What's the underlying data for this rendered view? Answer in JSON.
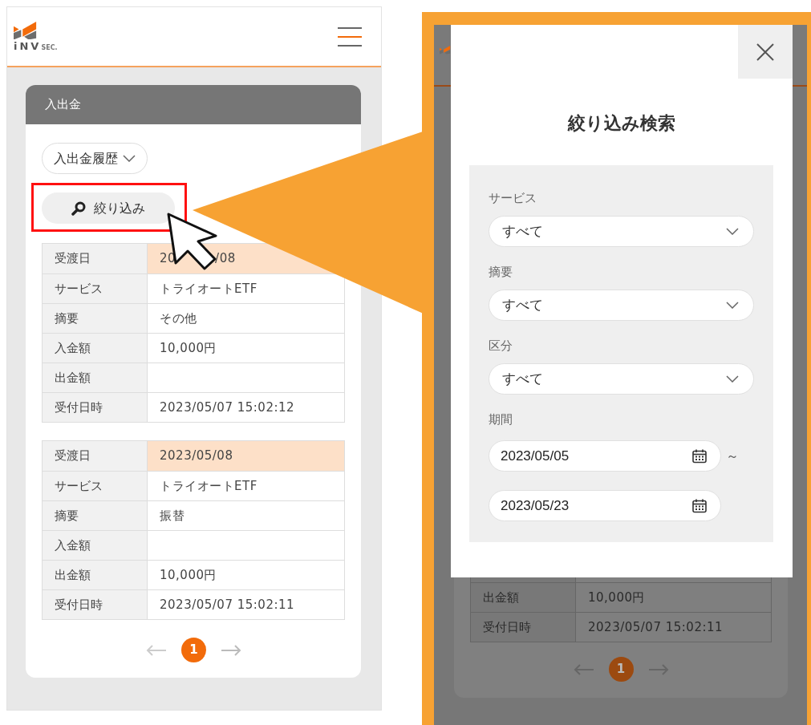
{
  "left_screen": {
    "header": {
      "logo_text": "iNV",
      "logo_suffix": "SEC."
    },
    "section_title": "入出金",
    "history_dropdown": "入出金履歴",
    "filter_button": "絞り込み",
    "records": [
      {
        "fields": [
          {
            "label": "受渡日",
            "value_parts": [
              "20",
              "/08"
            ],
            "highlight": true
          },
          {
            "label": "サービス",
            "value": "トライオートETF",
            "highlight": false
          },
          {
            "label": "摘要",
            "value": "その他",
            "highlight": false
          },
          {
            "label": "入金額",
            "value": "10,000円",
            "highlight": false
          },
          {
            "label": "出金額",
            "highlight": false
          },
          {
            "label": "受付日時",
            "value": "2023/05/07 15:02:12",
            "highlight": false
          }
        ]
      },
      {
        "fields": [
          {
            "label": "受渡日",
            "value": "2023/05/08",
            "highlight": true
          },
          {
            "label": "サービス",
            "value": "トライオートETF",
            "highlight": false
          },
          {
            "label": "摘要",
            "value": "振替",
            "highlight": false
          },
          {
            "label": "入金額",
            "highlight": false
          },
          {
            "label": "出金額",
            "value": "10,000円",
            "highlight": false
          },
          {
            "label": "受付日時",
            "value": "2023/05/07 15:02:11",
            "highlight": false
          }
        ]
      }
    ],
    "pagination": [
      {
        "label": "1",
        "selected": true
      }
    ]
  },
  "right_screen": {
    "modal": {
      "title": "絞り込み検索",
      "fields": [
        {
          "kind": "select",
          "label": "サービス",
          "value": "すべて"
        },
        {
          "kind": "select",
          "label": "摘要",
          "value": "すべて"
        },
        {
          "kind": "select",
          "label": "区分",
          "value": "すべて"
        },
        {
          "kind": "date_range",
          "label": "期間",
          "from": "2023/05/05",
          "to": "2023/05/23",
          "separator": "～"
        }
      ]
    },
    "background_rows": [
      {
        "label": "出金額",
        "value": "10,000円"
      },
      {
        "label": "受付日時",
        "value": "2023/05/07 15:02:11"
      }
    ],
    "pagination": [
      {
        "label": "1",
        "selected": true
      }
    ]
  }
}
